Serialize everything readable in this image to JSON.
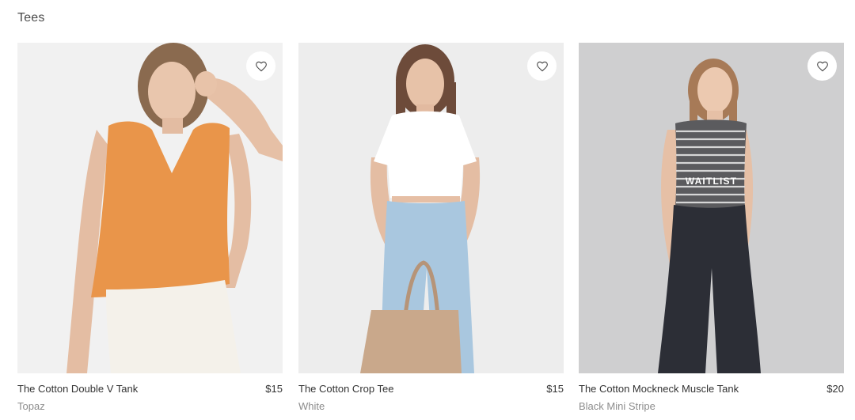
{
  "section": {
    "title": "Tees"
  },
  "products": [
    {
      "name": "The Cotton Double V Tank",
      "price": "$15",
      "color": "Topaz",
      "wishlist_icon": "heart-icon",
      "image_colors": {
        "background": "#f1f1f1",
        "garment": "#e9954a",
        "bottom": "#f4f1ea"
      }
    },
    {
      "name": "The Cotton Crop Tee",
      "price": "$15",
      "color": "White",
      "wishlist_icon": "heart-icon",
      "image_colors": {
        "background": "#ededed",
        "garment": "#ffffff",
        "bottom": "#a9c7df",
        "bag": "#c9a88b"
      }
    },
    {
      "name": "The Cotton Mockneck Muscle Tank",
      "price": "$20",
      "color": "Black Mini Stripe",
      "wishlist_icon": "heart-icon",
      "overlay_label": "WAITLIST",
      "image_colors": {
        "background": "#cfcfd0",
        "garment": "#5b5b5e",
        "bottom": "#2c2e36"
      }
    }
  ]
}
